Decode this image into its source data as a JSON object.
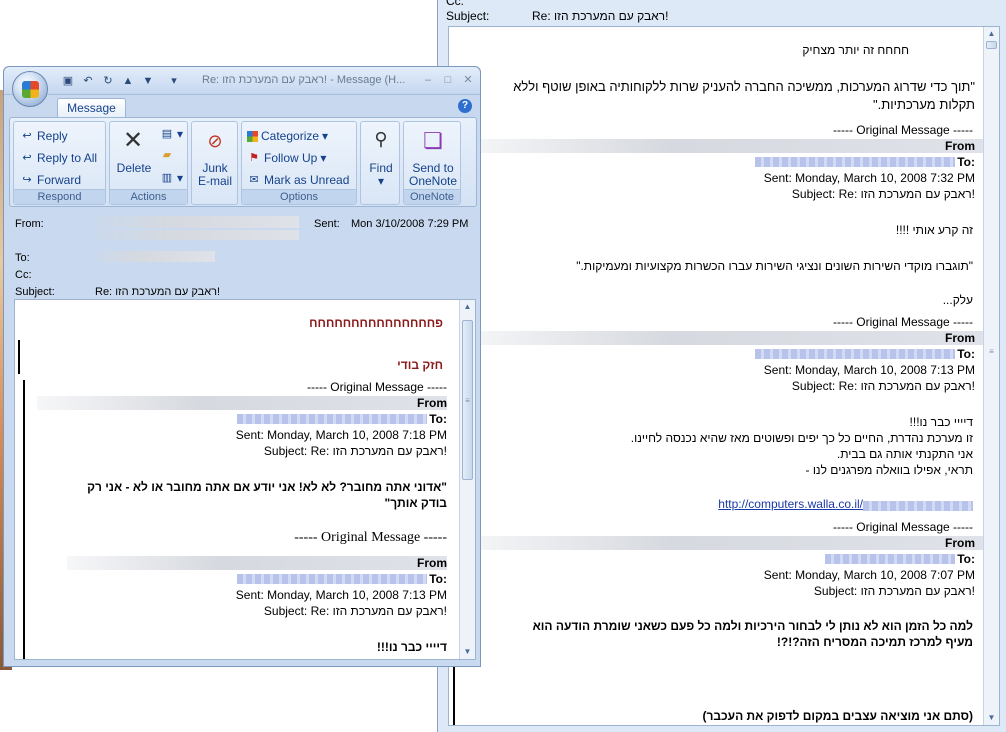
{
  "back": {
    "subject_label": "Subject:",
    "subject_value": "Re: ראבק עם המערכת הזו!",
    "body": {
      "l1": "חחחח זה יותר מצחיק",
      "l2": "\"תוך כדי שדרוג המערכות, ממשיכה החברה להעניק שרות ללקוחותיה באופן שוטף וללא",
      "l3": "תקלות מערכתיות.\"",
      "orig": "----- Original Message -----",
      "from": "From",
      "to": "To:",
      "sent1": "Sent: Monday, March 10, 2008 7:32 PM",
      "subj": "Subject: Re: ראבק עם המערכת הזו!",
      "l4": "זה קרע אותי !!!!",
      "l5": "\"תוגברו מוקדי השירות השונים ונציגי השירות עברו הכשרות מקצועיות ומעמיקות.\"",
      "l6": "עלק...",
      "sent2": "Sent: Monday, March 10, 2008 7:13 PM",
      "l7": "דיייי כבר נו!!!",
      "l8": "זו מערכת נהדרת, החיים כל כך יפים ופשוטים מאז שהיא נכנסה לחיינו.",
      "l9": "אני התקנתי אותה גם בבית.",
      "l10": "תראי, אפילו בוואלה מפרגנים לנו -",
      "link": "http://computers.walla.co.il/",
      "sent3": "Sent: Monday, March 10, 2008 7:07 PM",
      "subj3": "Subject: ראבק עם המערכת הזו!",
      "l11": "למה כל הזמן הוא לא נותן לי לבחור הירכיות ולמה כל פעם כשאני שומרת הודעה הוא",
      "l12": "מעיף למרכז תמיכה המסריח הזה?!?!",
      "l13": "(סתם אני מוציאה עצבים במקום לדפוק את העכבר)"
    }
  },
  "front": {
    "title": "Re: ראבק עם המערכת הזו! - Message (H...",
    "tab": "Message",
    "help": "?",
    "ribbon": {
      "respond": {
        "label": "Respond",
        "reply": "Reply",
        "reply_all": "Reply to All",
        "forward": "Forward"
      },
      "actions": {
        "label": "Actions",
        "delete": "Delete"
      },
      "junk": {
        "line1": "Junk",
        "line2": "E-mail"
      },
      "options": {
        "label": "Options",
        "categorize": "Categorize",
        "follow_up": "Follow Up",
        "mark_unread": "Mark as Unread"
      },
      "find": {
        "label": "Find"
      },
      "onenote": {
        "label": "OneNote",
        "line1": "Send to",
        "line2": "OneNote"
      }
    },
    "headers": {
      "from_label": "From:",
      "sent_label": "Sent:",
      "sent_value": "Mon 3/10/2008 7:29 PM",
      "to_label": "To:",
      "cc_label": "Cc:",
      "subject_label": "Subject:",
      "subject_value": "Re: ראבק עם המערכת הזו!"
    },
    "body": {
      "l1": "פחחחחחחחחחחחחחחח",
      "l2": "חזק בודי",
      "orig": "----- Original Message -----",
      "from": "From",
      "to": "To:",
      "sent1": "Sent: Monday, March 10, 2008 7:18 PM",
      "subj1": "Subject: Re: ראבק עם המערכת הזו!",
      "l3": "\"אדוני אתה מחובר? לא לא! אני יודע אם אתה מחובר או לא - אני רק",
      "l4": "בודק אותך\"",
      "orig2": "----- Original Message -----",
      "sent2": "Sent: Monday, March 10, 2008 7:13 PM",
      "subj2": "Subject: Re: ראבק עם המערכת הזו!",
      "l5": "דיייי כבר נו!!!"
    }
  }
}
